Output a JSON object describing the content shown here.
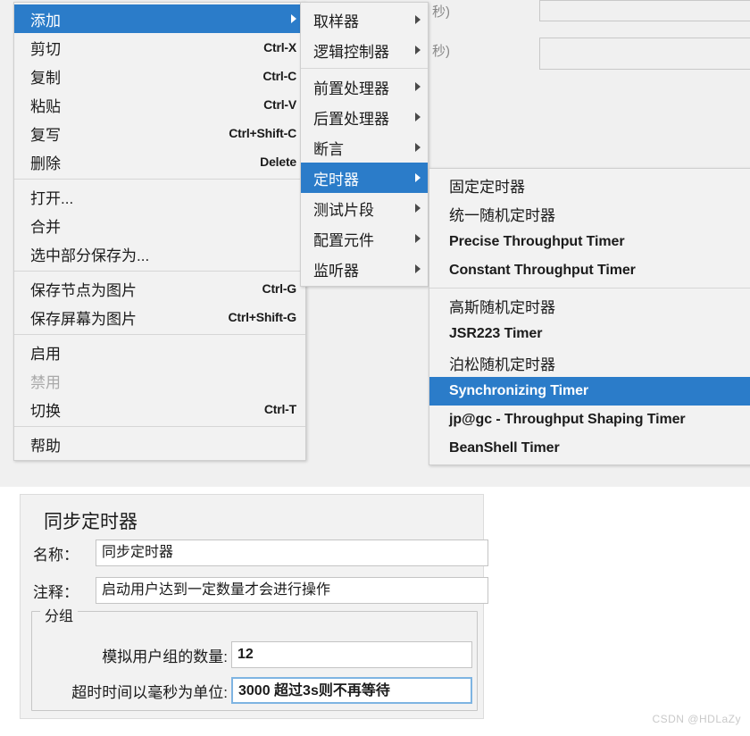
{
  "background_form": {
    "labels": [
      "秒)",
      "秒)"
    ],
    "fields": [
      "",
      ""
    ]
  },
  "menus": {
    "edit_menu": {
      "name": "edit-context-menu",
      "items": [
        {
          "label": "添加",
          "accel": "",
          "submenu": true,
          "selected": true,
          "disabled": false
        },
        {
          "label": "剪切",
          "accel": "Ctrl-X",
          "submenu": false,
          "selected": false,
          "disabled": false
        },
        {
          "label": "复制",
          "accel": "Ctrl-C",
          "submenu": false,
          "selected": false,
          "disabled": false
        },
        {
          "label": "粘贴",
          "accel": "Ctrl-V",
          "submenu": false,
          "selected": false,
          "disabled": false
        },
        {
          "label": "复写",
          "accel": "Ctrl+Shift-C",
          "submenu": false,
          "selected": false,
          "disabled": false
        },
        {
          "label": "删除",
          "accel": "Delete",
          "submenu": false,
          "selected": false,
          "disabled": false
        },
        {
          "separator": true
        },
        {
          "label": "打开...",
          "accel": "",
          "submenu": false,
          "selected": false,
          "disabled": false
        },
        {
          "label": "合并",
          "accel": "",
          "submenu": false,
          "selected": false,
          "disabled": false
        },
        {
          "label": "选中部分保存为...",
          "accel": "",
          "submenu": false,
          "selected": false,
          "disabled": false
        },
        {
          "separator": true
        },
        {
          "label": "保存节点为图片",
          "accel": "Ctrl-G",
          "submenu": false,
          "selected": false,
          "disabled": false
        },
        {
          "label": "保存屏幕为图片",
          "accel": "Ctrl+Shift-G",
          "submenu": false,
          "selected": false,
          "disabled": false
        },
        {
          "separator": true
        },
        {
          "label": "启用",
          "accel": "",
          "submenu": false,
          "selected": false,
          "disabled": false
        },
        {
          "label": "禁用",
          "accel": "",
          "submenu": false,
          "selected": false,
          "disabled": true
        },
        {
          "label": "切换",
          "accel": "Ctrl-T",
          "submenu": false,
          "selected": false,
          "disabled": false
        },
        {
          "separator": true
        },
        {
          "label": "帮助",
          "accel": "",
          "submenu": false,
          "selected": false,
          "disabled": false
        }
      ]
    },
    "add_submenu": {
      "name": "add-submenu",
      "items": [
        {
          "label": "取样器",
          "submenu": true,
          "selected": false
        },
        {
          "label": "逻辑控制器",
          "submenu": true,
          "selected": false
        },
        {
          "separator": true
        },
        {
          "label": "前置处理器",
          "submenu": true,
          "selected": false
        },
        {
          "label": "后置处理器",
          "submenu": true,
          "selected": false
        },
        {
          "label": "断言",
          "submenu": true,
          "selected": false
        },
        {
          "label": "定时器",
          "submenu": true,
          "selected": true
        },
        {
          "label": "测试片段",
          "submenu": true,
          "selected": false
        },
        {
          "label": "配置元件",
          "submenu": true,
          "selected": false
        },
        {
          "label": "监听器",
          "submenu": true,
          "selected": false
        }
      ]
    },
    "timer_submenu": {
      "name": "timer-submenu",
      "items": [
        {
          "label": "固定定时器",
          "english": false,
          "selected": false
        },
        {
          "label": "统一随机定时器",
          "english": false,
          "selected": false
        },
        {
          "label": "Precise Throughput Timer",
          "english": true,
          "selected": false
        },
        {
          "label": "Constant Throughput Timer",
          "english": true,
          "selected": false
        },
        {
          "separator": true
        },
        {
          "label": "高斯随机定时器",
          "english": false,
          "selected": false
        },
        {
          "label": "JSR223 Timer",
          "english": true,
          "selected": false
        },
        {
          "label": "泊松随机定时器",
          "english": false,
          "selected": false
        },
        {
          "label": "Synchronizing Timer",
          "english": true,
          "selected": true
        },
        {
          "label": "jp@gc - Throughput Shaping Timer",
          "english": true,
          "selected": false
        },
        {
          "label": "BeanShell Timer",
          "english": true,
          "selected": false
        }
      ]
    }
  },
  "panel": {
    "title": "同步定时器",
    "name_label": "名称：",
    "name_value": "同步定时器",
    "comment_label": "注释：",
    "comment_value": "启动用户达到一定数量才会进行操作",
    "group_legend": "分组",
    "users_label": "模拟用户组的数量:",
    "users_value": "12",
    "timeout_label": "超时时间以毫秒为单位:",
    "timeout_value": "3000 超过3s则不再等待"
  },
  "watermark": "CSDN @HDLaZy",
  "colors": {
    "selection_blue": "#2b7cc9",
    "menu_bg": "#f2f2f2",
    "panel_bg": "#f2f2f2",
    "focus_border": "#7eb4e2"
  }
}
